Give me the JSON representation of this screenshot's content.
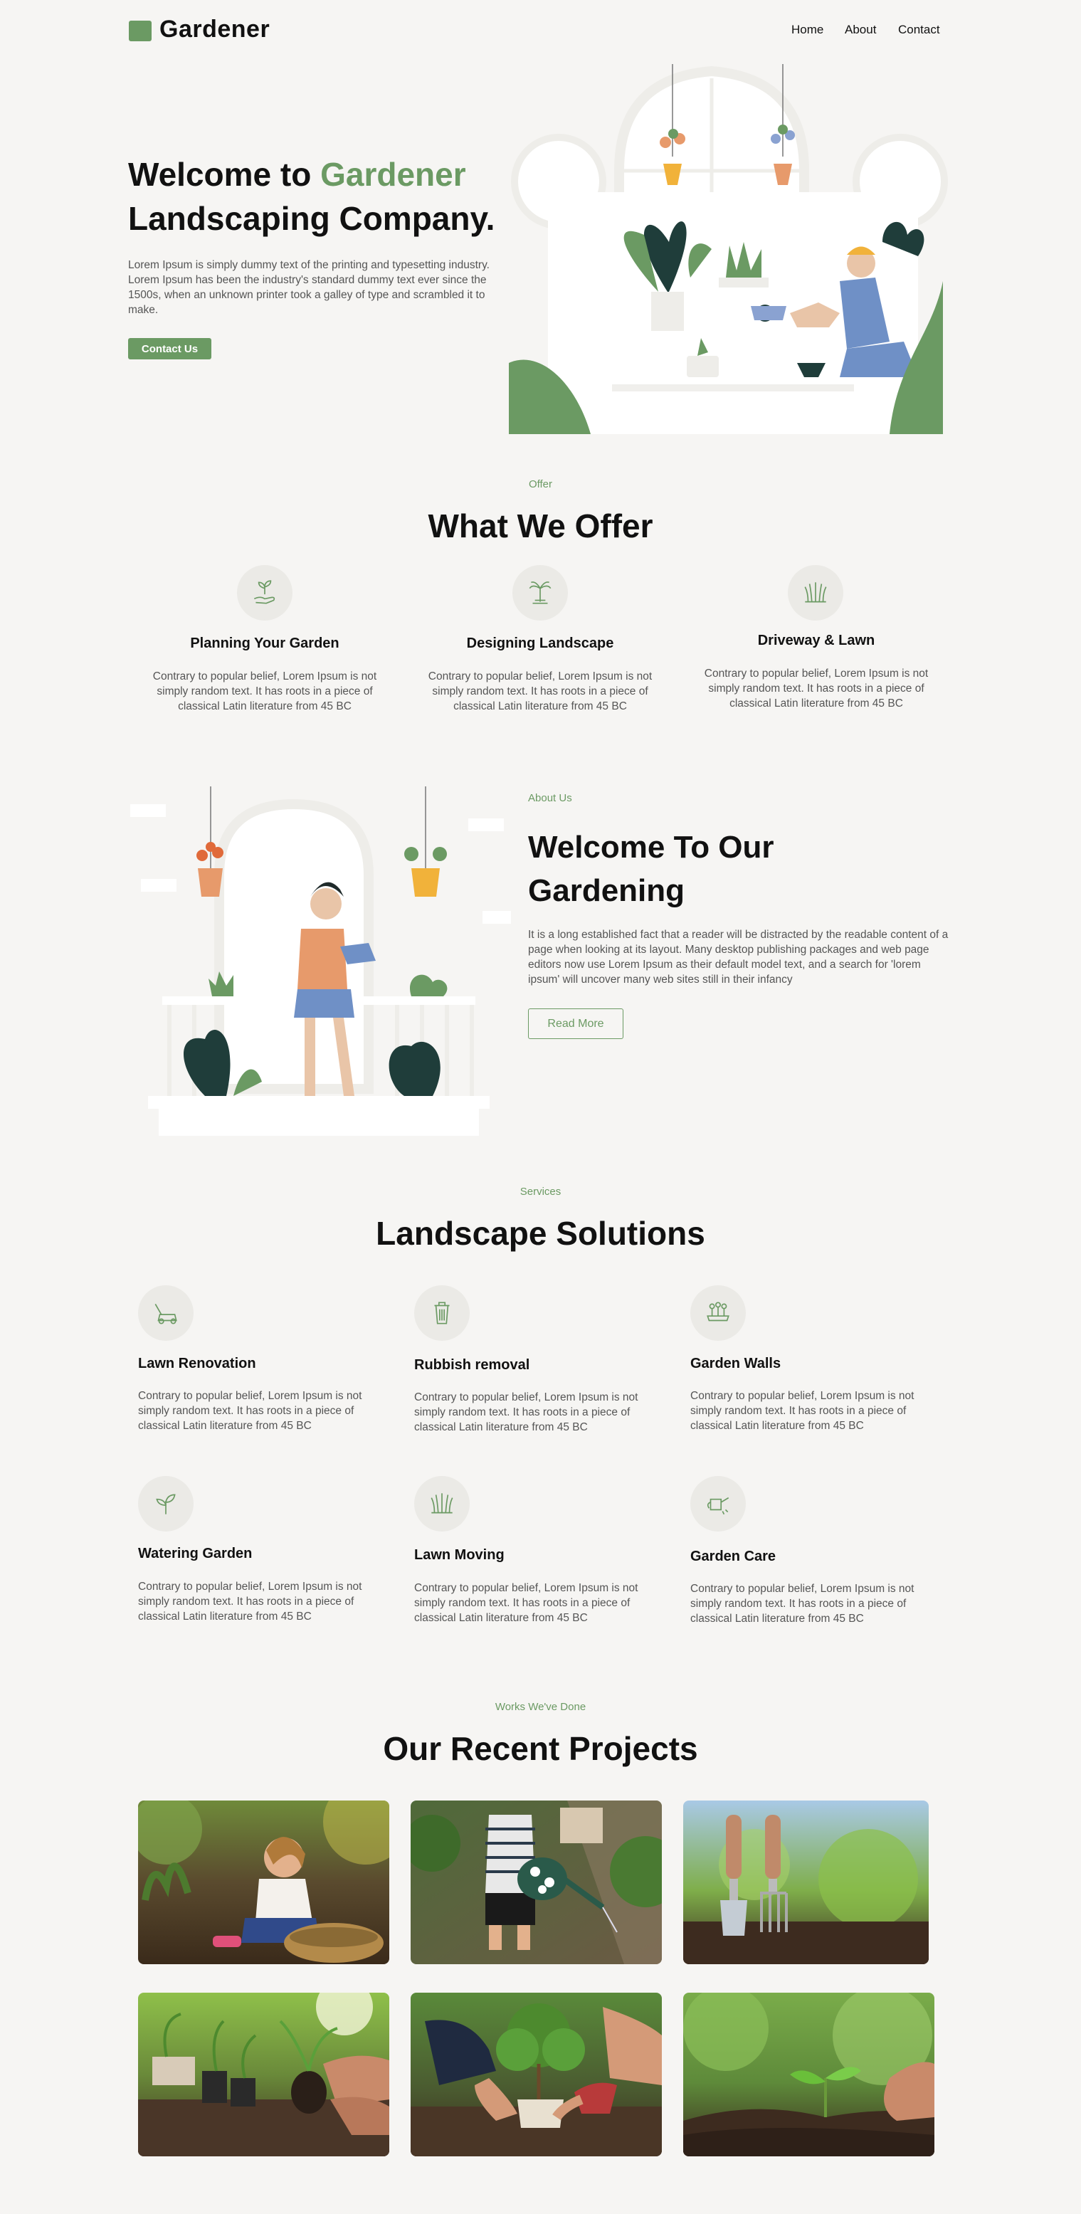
{
  "brand": {
    "name": "Gardener",
    "accent_color": "#6b9a63"
  },
  "nav": {
    "items": [
      "Home",
      "About",
      "Contact"
    ]
  },
  "hero": {
    "title_prefix": "Welcome to ",
    "title_accent": "Gardener",
    "title_line2": "Landscaping Company.",
    "text": "Lorem Ipsum is simply dummy text of the printing and typesetting industry. Lorem Ipsum has been the industry's standard dummy text ever since the 1500s, when an unknown printer took a galley of type and scrambled it to make.",
    "button": "Contact Us"
  },
  "offer": {
    "kicker": "Offer",
    "title": "What We Offer",
    "items": [
      {
        "icon": "hand-sprout-icon",
        "title": "Planning Your Garden",
        "text": "Contrary to popular belief, Lorem Ipsum is not simply random text. It has roots in a piece of classical Latin literature from 45 BC"
      },
      {
        "icon": "palm-tree-icon",
        "title": "Designing Landscape",
        "text": "Contrary to popular belief, Lorem Ipsum is not simply random text. It has roots in a piece of classical Latin literature from 45 BC"
      },
      {
        "icon": "grass-icon",
        "title": "Driveway & Lawn",
        "text": "Contrary to popular belief, Lorem Ipsum is not simply random text. It has roots in a piece of classical Latin literature from 45 BC"
      }
    ]
  },
  "about": {
    "kicker": "About Us",
    "title": "Welcome To Our Gardening",
    "text": "It is a long established fact that a reader will be distracted by the readable content of a page when looking at its layout. Many desktop publishing packages and web page editors now use Lorem Ipsum as their default model text, and a search for 'lorem ipsum' will uncover many web sites still in their infancy",
    "button": "Read More"
  },
  "services": {
    "kicker": "Services",
    "title": "Landscape Solutions",
    "items": [
      {
        "icon": "lawn-mower-icon",
        "title": "Lawn Renovation",
        "text": "Contrary to popular belief, Lorem Ipsum is not simply random text. It has roots in a piece of classical Latin literature from 45 BC"
      },
      {
        "icon": "trash-bin-icon",
        "title": "Rubbish removal",
        "text": "Contrary to popular belief, Lorem Ipsum is not simply random text. It has roots in a piece of classical Latin literature from 45 BC"
      },
      {
        "icon": "garden-wall-icon",
        "title": "Garden Walls",
        "text": "Contrary to popular belief, Lorem Ipsum is not simply random text. It has roots in a piece of classical Latin literature from 45 BC"
      },
      {
        "icon": "sprout-icon",
        "title": "Watering Garden",
        "text": "Contrary to popular belief, Lorem Ipsum is not simply random text. It has roots in a piece of classical Latin literature from 45 BC"
      },
      {
        "icon": "grass-icon",
        "title": "Lawn Moving",
        "text": "Contrary to popular belief, Lorem Ipsum is not simply random text. It has roots in a piece of classical Latin literature from 45 BC"
      },
      {
        "icon": "watering-can-icon",
        "title": "Garden Care",
        "text": "Contrary to popular belief, Lorem Ipsum is not simply random text. It has roots in a piece of classical Latin literature from 45 BC"
      }
    ]
  },
  "projects": {
    "kicker": "Works We've Done",
    "title": "Our Recent Projects",
    "photos": [
      "child-planting-photo",
      "child-watering-photo",
      "garden-tools-photo",
      "hands-transplanting-photo",
      "hands-planting-tree-photo",
      "seedling-in-soil-photo"
    ]
  }
}
